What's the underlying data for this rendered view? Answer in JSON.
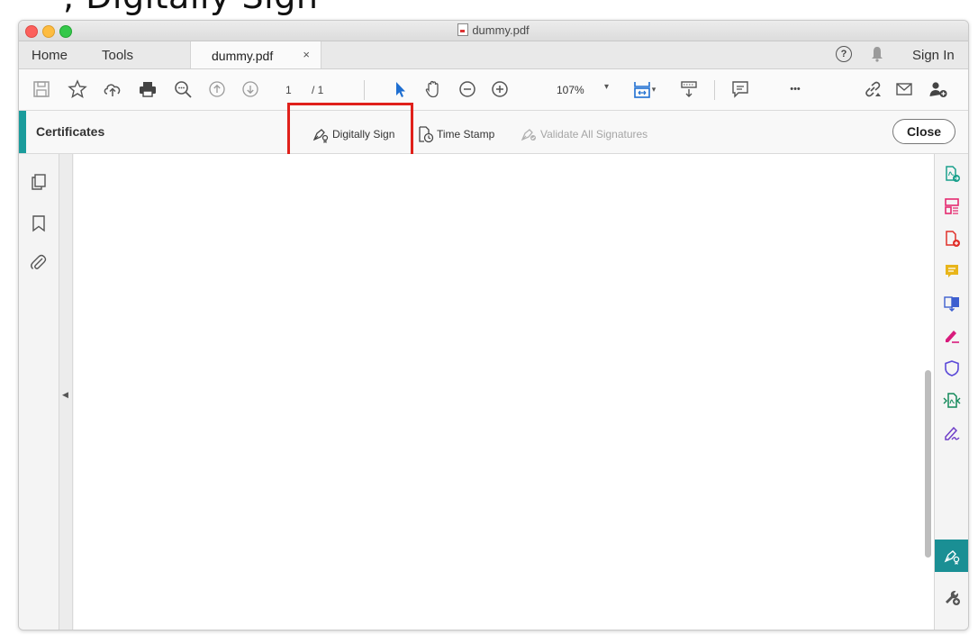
{
  "page_heading_fragment": ", Digitally Sign",
  "window": {
    "title": "dummy.pdf"
  },
  "tabbar": {
    "home": "Home",
    "tools": "Tools",
    "doc_tab": "dummy.pdf",
    "close_glyph": "×",
    "help_glyph": "?",
    "sign_in": "Sign In"
  },
  "toolbar": {
    "page_current": "1",
    "page_total": "/ 1",
    "zoom": "107%",
    "zoom_arrow": "▾",
    "more_glyph": "•••"
  },
  "secondary": {
    "title": "Certificates",
    "digitally_sign": "Digitally Sign",
    "time_stamp": "Time Stamp",
    "validate_all": "Validate All Signatures",
    "close": "Close"
  },
  "collapse_glyph": "◀",
  "colors": {
    "accent": "#1a9c9c",
    "highlight": "#e0201b",
    "active_tool": "#1a8f94"
  },
  "right_tools": [
    "create-pdf-icon",
    "organize-pages-icon",
    "export-pdf-icon",
    "comment-icon",
    "combine-files-icon",
    "fill-sign-icon",
    "protect-icon",
    "compress-pdf-icon",
    "request-signatures-icon",
    "certificates-icon",
    "more-tools-icon"
  ]
}
